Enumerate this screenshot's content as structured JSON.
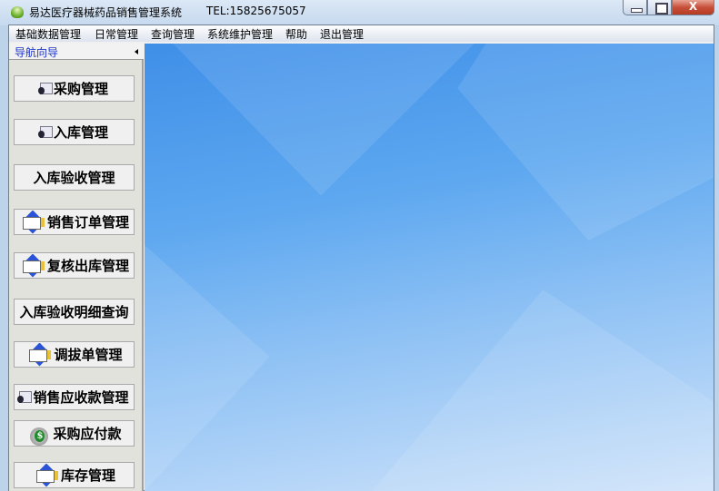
{
  "window": {
    "title": "易达医疗器械药品销售管理系统",
    "tel": "TEL:15825675057",
    "close_label": "X"
  },
  "menu": [
    "基础数据管理",
    "日常管理",
    "查询管理",
    "系统维护管理",
    "帮助",
    "退出管理"
  ],
  "nav": {
    "header": "导航向导",
    "buttons": [
      {
        "label": "采购管理",
        "icon": "card"
      },
      {
        "label": "入库管理",
        "icon": "card"
      },
      {
        "label": "入库验收管理",
        "icon": "none"
      },
      {
        "label": "销售订单管理",
        "icon": "doc"
      },
      {
        "label": "复核出库管理",
        "icon": "doc"
      },
      {
        "label": "入库验收明细查询",
        "icon": "none"
      },
      {
        "label": "调拔单管理",
        "icon": "doc"
      },
      {
        "label": "销售应收款管理",
        "icon": "card"
      },
      {
        "label": "采购应付款",
        "icon": "money"
      },
      {
        "label": "库存管理",
        "icon": "doc"
      }
    ]
  }
}
